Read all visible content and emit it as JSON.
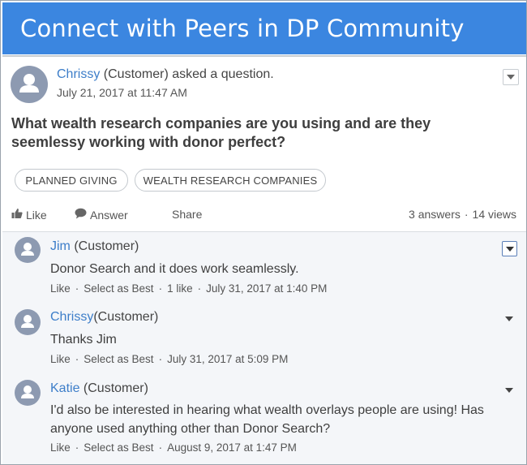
{
  "banner": {
    "title": "Connect with Peers in DP Community"
  },
  "question": {
    "author": "Chrissy",
    "role": "(Customer)",
    "action": " asked a question.",
    "date": "July 21, 2017 at 11:47 AM",
    "title": "What wealth research companies are you using and are they seemlessy working with donor perfect?",
    "tags": [
      "PLANNED GIVING",
      "WEALTH RESEARCH COMPANIES"
    ],
    "actions": {
      "like": "Like",
      "answer": "Answer",
      "share": "Share"
    },
    "stats": {
      "answers": "3 answers",
      "views": "14 views"
    }
  },
  "comments": [
    {
      "author": "Jim",
      "role": "(Customer)",
      "text": "Donor Search and it does work seamlessly.",
      "like": "Like",
      "select_best": "Select as Best",
      "likes": "1 like",
      "date": "July 31, 2017 at 1:40 PM"
    },
    {
      "author": "Chrissy",
      "role": "(Customer)",
      "text": "Thanks Jim",
      "like": "Like",
      "select_best": "Select as Best",
      "date": "July 31, 2017 at 5:09 PM"
    },
    {
      "author": "Katie",
      "role": "(Customer)",
      "text": "I'd also be interested in hearing what wealth overlays people are using! Has anyone used anything other than Donor Search?",
      "like": "Like",
      "select_best": "Select as Best",
      "date": "August 9, 2017 at 1:47 PM"
    }
  ],
  "separator": "·",
  "colors": {
    "banner": "#3b86e0",
    "link": "#3d7ec9",
    "avatar": "#8d9ab1",
    "answers_bg": "#f4f6f9"
  },
  "icons": {
    "like": "thumbs-up-icon",
    "answer": "speech-bubble-icon",
    "avatar": "user-silhouette-icon",
    "menu": "chevron-down-icon"
  }
}
